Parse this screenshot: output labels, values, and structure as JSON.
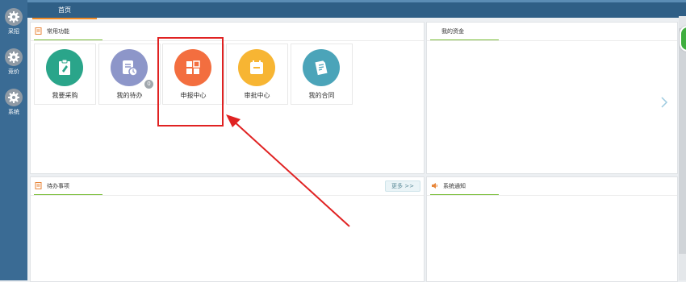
{
  "sidebar": {
    "items": [
      {
        "label": "采招"
      },
      {
        "label": "竞价"
      },
      {
        "label": "系统"
      }
    ]
  },
  "tabs": {
    "home": "首页"
  },
  "panels": {
    "common": {
      "title": "常用功能",
      "functions": [
        {
          "label": "我要采购",
          "icon": "clipboard-pen-icon",
          "color": "#2aa58a"
        },
        {
          "label": "我的待办",
          "icon": "todo-clock-icon",
          "color": "#8d96c9",
          "badge": "0"
        },
        {
          "label": "申报中心",
          "icon": "grid-icon",
          "color": "#f36e3f"
        },
        {
          "label": "审批中心",
          "icon": "calendar-icon",
          "color": "#f7b533"
        },
        {
          "label": "我的合同",
          "icon": "contract-icon",
          "color": "#4ba4b9"
        }
      ]
    },
    "funds": {
      "title": "我的资金"
    },
    "todo": {
      "title": "待办事项",
      "more_label": "更多 >>"
    },
    "notices": {
      "title": "系统通知"
    }
  },
  "colors": {
    "sidebar": "#3a6b94",
    "topbar": "#2f5f86",
    "accent_tab": "#f08a24",
    "panel_underline": "#7bbf3a",
    "highlight": "#e02222"
  }
}
